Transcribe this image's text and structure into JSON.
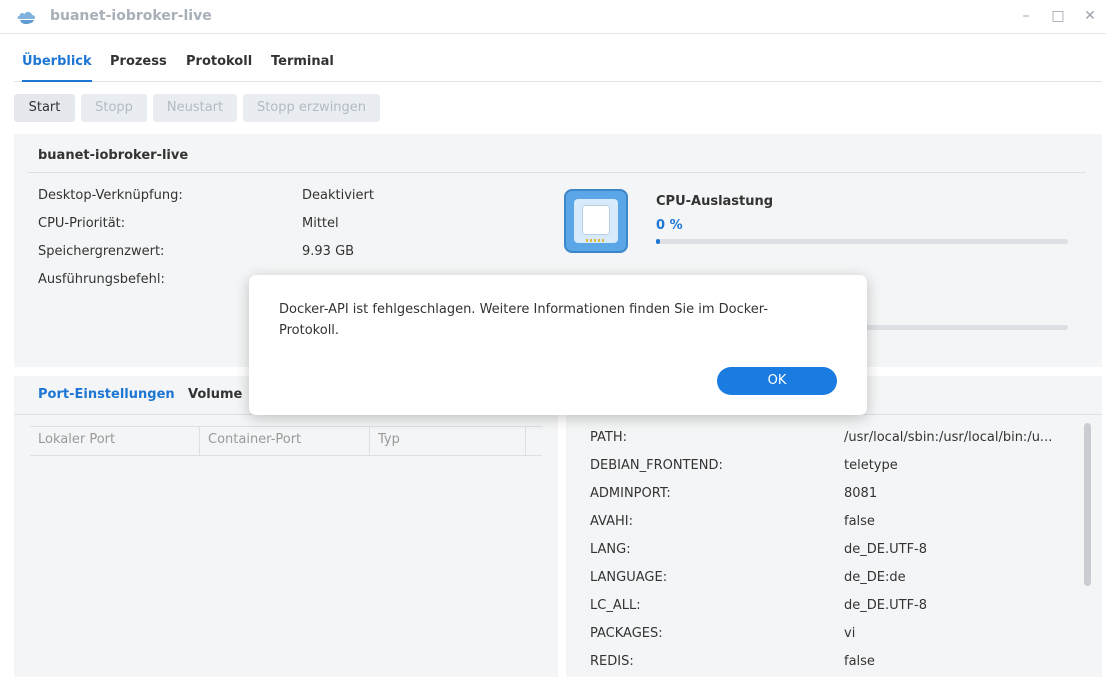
{
  "window": {
    "title": "buanet-iobroker-live",
    "app_icon": "cloud-docker-icon",
    "controls": {
      "minimize": "–",
      "maximize": "□",
      "close": "✕"
    }
  },
  "tabs": [
    {
      "label": "Überblick",
      "active": true
    },
    {
      "label": "Prozess",
      "active": false
    },
    {
      "label": "Protokoll",
      "active": false
    },
    {
      "label": "Terminal",
      "active": false
    }
  ],
  "toolbar": {
    "start": "Start",
    "stop": "Stopp",
    "restart": "Neustart",
    "force_stop": "Stopp erzwingen"
  },
  "overview": {
    "container_name": "buanet-iobroker-live",
    "fields": [
      {
        "label": "Desktop-Verknüpfung:",
        "value": "Deaktiviert"
      },
      {
        "label": "CPU-Priorität:",
        "value": "Mittel"
      },
      {
        "label": "Speichergrenzwert:",
        "value": "9.93 GB"
      },
      {
        "label": "Ausführungsbefehl:",
        "value": ""
      }
    ],
    "cpu": {
      "title": "CPU-Auslastung",
      "value": "0 %",
      "fill_percent": 1
    },
    "memory": {
      "fill_percent": 0
    }
  },
  "ports": {
    "tabs": [
      "Port-Einstellungen",
      "Volume"
    ],
    "columns": [
      "Lokaler Port",
      "Container-Port",
      "Typ"
    ]
  },
  "env": [
    {
      "key": "PATH:",
      "value": "/usr/local/sbin:/usr/local/bin:/u..."
    },
    {
      "key": "DEBIAN_FRONTEND:",
      "value": "teletype"
    },
    {
      "key": "ADMINPORT:",
      "value": "8081"
    },
    {
      "key": "AVAHI:",
      "value": "false"
    },
    {
      "key": "LANG:",
      "value": "de_DE.UTF-8"
    },
    {
      "key": "LANGUAGE:",
      "value": "de_DE:de"
    },
    {
      "key": "LC_ALL:",
      "value": "de_DE.UTF-8"
    },
    {
      "key": "PACKAGES:",
      "value": "vi"
    },
    {
      "key": "REDIS:",
      "value": "false"
    }
  ],
  "dialog": {
    "message": "Docker-API ist fehlgeschlagen. Weitere Informationen finden Sie im Docker-Protokoll.",
    "ok": "OK"
  },
  "colors": {
    "accent": "#1e76d4",
    "panel": "#f4f5f6"
  }
}
